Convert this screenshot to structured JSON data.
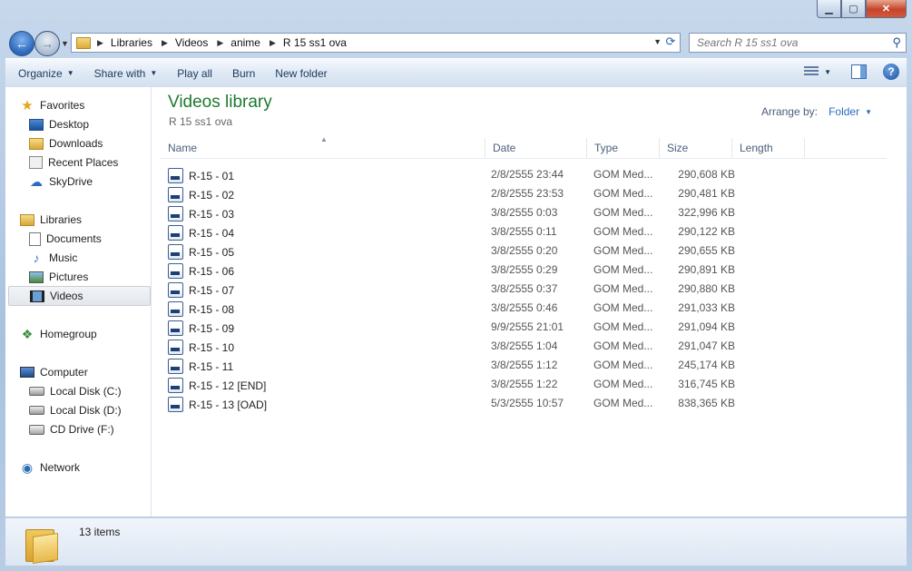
{
  "window": {
    "controls": {
      "minimize": "▁",
      "maximize": "▢",
      "close": "✕"
    }
  },
  "nav": {
    "breadcrumbs": [
      "Libraries",
      "Videos",
      "anime",
      "R 15 ss1 ova"
    ],
    "search_placeholder": "Search R 15 ss1 ova"
  },
  "toolbar": {
    "organize": "Organize",
    "share_with": "Share with",
    "play_all": "Play all",
    "burn": "Burn",
    "new_folder": "New folder"
  },
  "sidebar": {
    "favorites": {
      "label": "Favorites",
      "items": [
        "Desktop",
        "Downloads",
        "Recent Places",
        "SkyDrive"
      ]
    },
    "libraries": {
      "label": "Libraries",
      "items": [
        "Documents",
        "Music",
        "Pictures",
        "Videos"
      ]
    },
    "homegroup": "Homegroup",
    "computer": {
      "label": "Computer",
      "items": [
        "Local Disk (C:)",
        "Local Disk (D:)",
        "CD Drive (F:)"
      ]
    },
    "network": "Network",
    "selected": "Videos"
  },
  "library": {
    "title": "Videos library",
    "subtitle": "R 15 ss1 ova",
    "arrange_label": "Arrange by:",
    "arrange_value": "Folder"
  },
  "columns": {
    "name": "Name",
    "date": "Date",
    "type": "Type",
    "size": "Size",
    "length": "Length"
  },
  "files": [
    {
      "name": "R-15 - 01",
      "date": "2/8/2555 23:44",
      "type": "GOM Med...",
      "size": "290,608 KB"
    },
    {
      "name": "R-15 - 02",
      "date": "2/8/2555 23:53",
      "type": "GOM Med...",
      "size": "290,481 KB"
    },
    {
      "name": "R-15 - 03",
      "date": "3/8/2555 0:03",
      "type": "GOM Med...",
      "size": "322,996 KB"
    },
    {
      "name": "R-15 - 04",
      "date": "3/8/2555 0:11",
      "type": "GOM Med...",
      "size": "290,122 KB"
    },
    {
      "name": "R-15 - 05",
      "date": "3/8/2555 0:20",
      "type": "GOM Med...",
      "size": "290,655 KB"
    },
    {
      "name": "R-15 - 06",
      "date": "3/8/2555 0:29",
      "type": "GOM Med...",
      "size": "290,891 KB"
    },
    {
      "name": "R-15 - 07",
      "date": "3/8/2555 0:37",
      "type": "GOM Med...",
      "size": "290,880 KB"
    },
    {
      "name": "R-15 - 08",
      "date": "3/8/2555 0:46",
      "type": "GOM Med...",
      "size": "291,033 KB"
    },
    {
      "name": "R-15 - 09",
      "date": "9/9/2555 21:01",
      "type": "GOM Med...",
      "size": "291,094 KB"
    },
    {
      "name": "R-15 - 10",
      "date": "3/8/2555 1:04",
      "type": "GOM Med...",
      "size": "291,047 KB"
    },
    {
      "name": "R-15 - 11",
      "date": "3/8/2555 1:12",
      "type": "GOM Med...",
      "size": "245,174 KB"
    },
    {
      "name": "R-15 - 12 [END]",
      "date": "3/8/2555 1:22",
      "type": "GOM Med...",
      "size": "316,745 KB"
    },
    {
      "name": "R-15 - 13 [OAD]",
      "date": "5/3/2555 10:57",
      "type": "GOM Med...",
      "size": "838,365 KB"
    }
  ],
  "details": {
    "item_count": "13 items"
  },
  "colors": {
    "accent_title": "#1e7a2e",
    "link": "#2a6bbf"
  }
}
